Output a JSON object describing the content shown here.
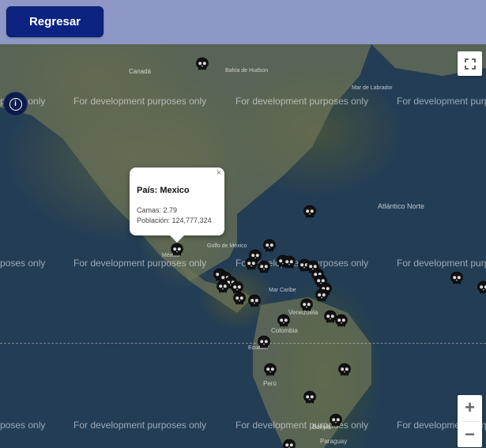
{
  "header": {
    "back_label": "Regresar"
  },
  "map": {
    "watermark": "For development purposes only",
    "watermark_partial": "poses only",
    "places": {
      "canada": "Canadá",
      "hudson": "Bahía de Hudson",
      "labrador": "Mar de Labrador",
      "atlantic": "Atlántico Norte",
      "gulf": "Golfo de México",
      "caribbean": "Mar Caribe",
      "venezuela": "Venezuela",
      "colombia": "Colombia",
      "ecuador": "Ecuador",
      "peru": "Perú",
      "bolivia": "Bolivia",
      "paraguay": "Paraguay",
      "mexico": "México"
    },
    "marker_icon": "skull-icon",
    "controls": {
      "zoom_in": "+",
      "zoom_out": "−",
      "fullscreen_icon": "fullscreen-icon",
      "info_icon": "info-icon"
    }
  },
  "popup": {
    "title": "País: Mexico",
    "camas": "Camas: 2.79",
    "poblacion": "Población: 124,777,324",
    "close": "×"
  }
}
